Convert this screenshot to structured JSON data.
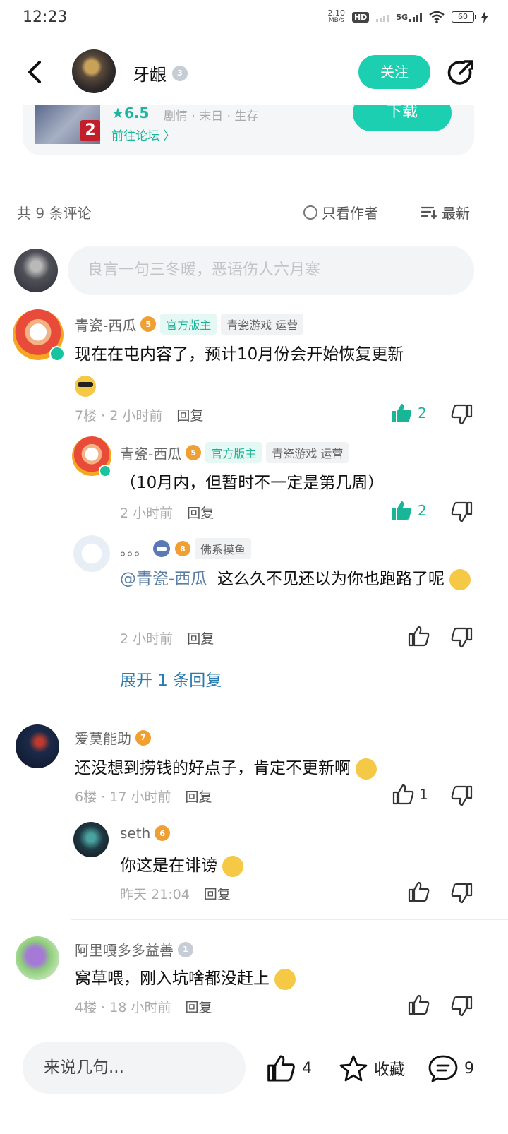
{
  "status_bar": {
    "time": "12:23",
    "net_speed_value": "2.10",
    "net_speed_unit": "MB/s",
    "hd_label": "HD",
    "signal_label": "5G",
    "battery": "60"
  },
  "header": {
    "username": "牙龈",
    "level": "3",
    "follow_label": "关注"
  },
  "game_card": {
    "rating": "6.5",
    "tags": "剧情 · 末日 · 生存",
    "forum_link": "前往论坛 〉",
    "download_label": "下载",
    "badge": "2"
  },
  "comments_bar": {
    "count_label": "共 9 条评论",
    "only_author_label": "只看作者",
    "sort_label": "最新"
  },
  "comment_input": {
    "placeholder": "良言一句三冬暖，恶语伤人六月寒"
  },
  "comments": [
    {
      "user": "青瓷-西瓜",
      "level": "5",
      "tag1": "官方版主",
      "tag2": "青瓷游戏 运营",
      "text": "现在在屯内容了，预计10月份会开始恢复更新",
      "floor": "7楼",
      "time": "2 小时前",
      "reply": "回复",
      "likes": "2",
      "replies": [
        {
          "user": "青瓷-西瓜",
          "level": "5",
          "tag1": "官方版主",
          "tag2": "青瓷游戏 运营",
          "text": "（10月内，但暂时不一定是第几周）",
          "time": "2 小时前",
          "reply": "回复",
          "likes": "2"
        },
        {
          "user": "。。。",
          "level": "8",
          "tag1": "佛系摸鱼",
          "mention": "@青瓷-西瓜",
          "text": "这么久不见还以为你也跑路了呢",
          "time": "2 小时前",
          "reply": "回复"
        }
      ],
      "expand_label": "展开 1 条回复"
    },
    {
      "user": "爱莫能助",
      "level": "7",
      "text": "还没想到捞钱的好点子，肯定不更新啊",
      "floor": "6楼",
      "time": "17 小时前",
      "reply": "回复",
      "likes": "1",
      "replies": [
        {
          "user": "seth",
          "level": "6",
          "text": "你这是在诽谤",
          "time": "昨天 21:04",
          "reply": "回复"
        }
      ]
    },
    {
      "user": "阿里嘎多多益善",
      "level": "1",
      "text": "窝草喂，刚入坑啥都没赶上",
      "floor": "4楼",
      "time": "18 小时前",
      "reply": "回复"
    }
  ],
  "bottom_bar": {
    "input_placeholder": "来说几句...",
    "likes": "4",
    "favorite_label": "收藏",
    "comments": "9"
  }
}
